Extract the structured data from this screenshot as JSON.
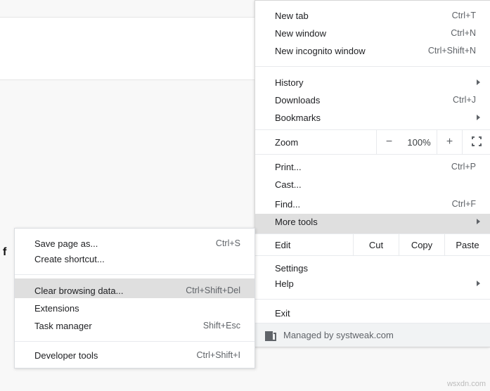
{
  "main_menu": {
    "new_tab": {
      "label": "New tab",
      "shortcut": "Ctrl+T"
    },
    "new_window": {
      "label": "New window",
      "shortcut": "Ctrl+N"
    },
    "new_incognito": {
      "label": "New incognito window",
      "shortcut": "Ctrl+Shift+N"
    },
    "history": {
      "label": "History"
    },
    "downloads": {
      "label": "Downloads",
      "shortcut": "Ctrl+J"
    },
    "bookmarks": {
      "label": "Bookmarks"
    },
    "zoom": {
      "label": "Zoom",
      "minus": "−",
      "value": "100%",
      "plus": "+"
    },
    "print": {
      "label": "Print...",
      "shortcut": "Ctrl+P"
    },
    "cast": {
      "label": "Cast..."
    },
    "find": {
      "label": "Find...",
      "shortcut": "Ctrl+F"
    },
    "more_tools": {
      "label": "More tools"
    },
    "edit": {
      "label": "Edit",
      "cut": "Cut",
      "copy": "Copy",
      "paste": "Paste"
    },
    "settings": {
      "label": "Settings"
    },
    "help": {
      "label": "Help"
    },
    "exit": {
      "label": "Exit"
    },
    "managed": {
      "label": "Managed by systweak.com"
    }
  },
  "sub_menu": {
    "save_page": {
      "label": "Save page as...",
      "shortcut": "Ctrl+S"
    },
    "create_shortcut": {
      "label": "Create shortcut..."
    },
    "clear_browsing": {
      "label": "Clear browsing data...",
      "shortcut": "Ctrl+Shift+Del"
    },
    "extensions": {
      "label": "Extensions"
    },
    "task_manager": {
      "label": "Task manager",
      "shortcut": "Shift+Esc"
    },
    "developer_tools": {
      "label": "Developer tools",
      "shortcut": "Ctrl+Shift+I"
    }
  },
  "watermark": "wsxdn.com"
}
